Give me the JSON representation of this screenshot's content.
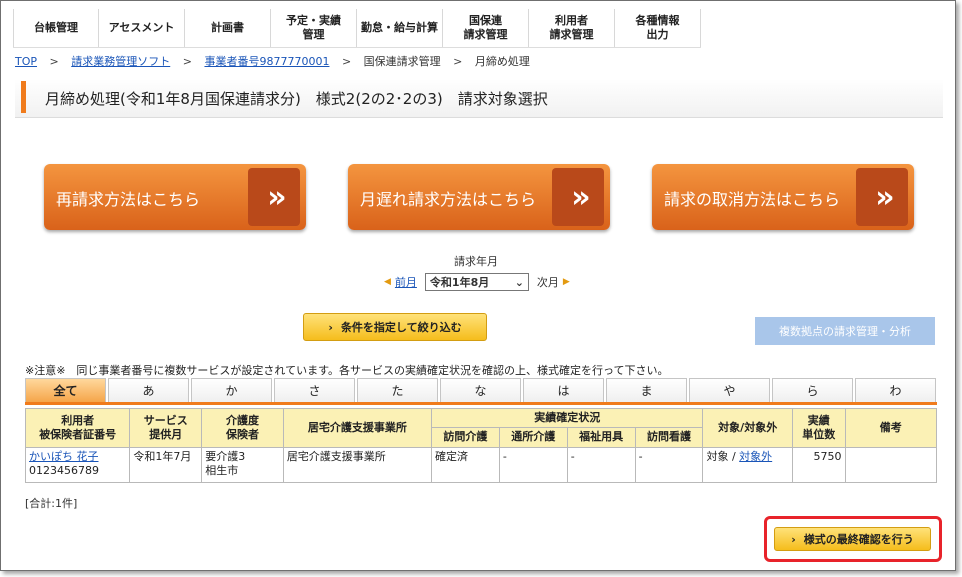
{
  "nav": [
    "台帳管理",
    "アセスメント",
    "計画書",
    "予定・実績\n管理",
    "勤怠・給与計算",
    "国保連\n請求管理",
    "利用者\n請求管理",
    "各種情報\n出力"
  ],
  "breadcrumb": {
    "top": "TOP",
    "software": "請求業務管理ソフト",
    "office": "事業者番号9877770001",
    "section": "国保連請求管理",
    "current": "月締め処理",
    "separator": ">"
  },
  "page_title": "月締め処理(令和1年8月国保連請求分)　様式2(2の2･2の3)　請求対象選択",
  "big_buttons": {
    "rebill": "再請求方法はこちら",
    "late": "月遅れ請求方法はこちら",
    "cancel": "請求の取消方法はこちら",
    "arrow": "»"
  },
  "month": {
    "label": "請求年月",
    "prev": "前月",
    "selected": "令和1年8月",
    "next": "次月"
  },
  "filter_button": "条件を指定して絞り込む",
  "multi_button": "複数拠点の請求管理・分析",
  "notice": "※注意※　同じ事業者番号に複数サービスが設定されています。各サービスの実績確定状況を確認の上、様式確定を行って下さい。",
  "kana_tabs": [
    "全て",
    "あ",
    "か",
    "さ",
    "た",
    "な",
    "は",
    "ま",
    "や",
    "ら",
    "わ"
  ],
  "table": {
    "headers": {
      "user": "利用者",
      "insured_no": "被保険者証番号",
      "service": "サービス",
      "service_month": "提供月",
      "care_level": "介護度",
      "insurer": "保険者",
      "office": "居宅介護支援事業所",
      "status": "実績確定状況",
      "visit_care": "訪問介護",
      "day_care": "通所介護",
      "welfare": "福祉用具",
      "visit_nursing": "訪問看護",
      "target": "対象/対象外",
      "units": "実績",
      "units2": "単位数",
      "remarks": "備考"
    },
    "rows": [
      {
        "name": "かいぽち 花子",
        "insured_no": "0123456789",
        "month": "令和1年7月",
        "care_level": "要介護3",
        "insurer": "相生市",
        "office": "居宅介護支援事業所",
        "visit_care": "確定済",
        "day_care": "-",
        "welfare": "-",
        "visit_nursing": "-",
        "target": "対象",
        "target_sep": "/",
        "non_target": "対象外",
        "units": "5750",
        "remarks": ""
      }
    ]
  },
  "total": "[合計:1件]",
  "final_button": "様式の最終確認を行う",
  "colors": {
    "accent": "#f07b1c",
    "link": "#1a55b8",
    "highlight": "#e8232a"
  }
}
